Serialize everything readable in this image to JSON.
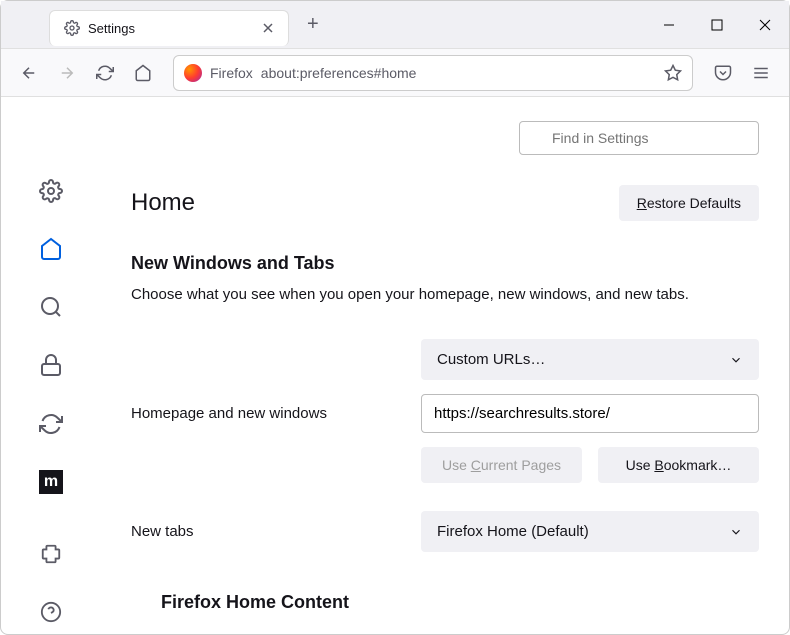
{
  "titlebar": {
    "tab_title": "Settings"
  },
  "toolbar": {
    "url_prefix": "Firefox",
    "url": "about:preferences#home"
  },
  "search": {
    "placeholder": "Find in Settings"
  },
  "page": {
    "title": "Home",
    "restore_label": "Restore Defaults",
    "section_title": "New Windows and Tabs",
    "section_desc": "Choose what you see when you open your homepage, new windows, and new tabs.",
    "homepage_label": "Homepage and new windows",
    "homepage_select": "Custom URLs…",
    "homepage_url": "https://searchresults.store/",
    "use_current": "Use Current Pages",
    "use_bookmark": "Use Bookmark…",
    "newtabs_label": "New tabs",
    "newtabs_select": "Firefox Home (Default)",
    "section2_title": "Firefox Home Content"
  }
}
